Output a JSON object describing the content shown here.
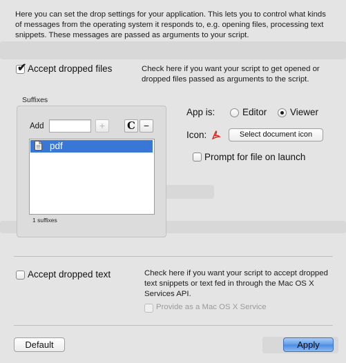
{
  "intro": "Here you can set the drop settings for your application. This lets you to control what kinds of messages from the operating system it responds to, e.g. opening files, processing text snippets. These messages are passed as arguments to your script.",
  "accept_files": {
    "label": "Accept dropped files",
    "checked": true,
    "description": "Check here if you want your script to get opened or dropped files passed as arguments to the script."
  },
  "suffixes": {
    "title": "Suffixes",
    "add_label": "Add",
    "add_value": "",
    "add_button": "+",
    "clear_button": "C",
    "remove_button": "−",
    "items": [
      "pdf"
    ],
    "selected_index": 0,
    "count_text": "1 suffixes"
  },
  "app_is": {
    "label": "App is:",
    "options": [
      "Editor",
      "Viewer"
    ],
    "selected": "Viewer"
  },
  "icon": {
    "label": "Icon:",
    "button": "Select document icon"
  },
  "prompt": {
    "label": "Prompt for file on launch",
    "checked": false
  },
  "accept_text": {
    "label": "Accept dropped text",
    "checked": false,
    "description": "Check here if you want your script to accept dropped text snippets or text fed in through the Mac OS X Services API."
  },
  "service": {
    "label": "Provide as a Mac OS X Service",
    "checked": false,
    "enabled": false
  },
  "footer": {
    "default_button": "Default",
    "apply_button": "Apply"
  },
  "colors": {
    "selection": "#3877d6",
    "background": "#e4e4e4",
    "primary_button": "#5f9be8"
  }
}
